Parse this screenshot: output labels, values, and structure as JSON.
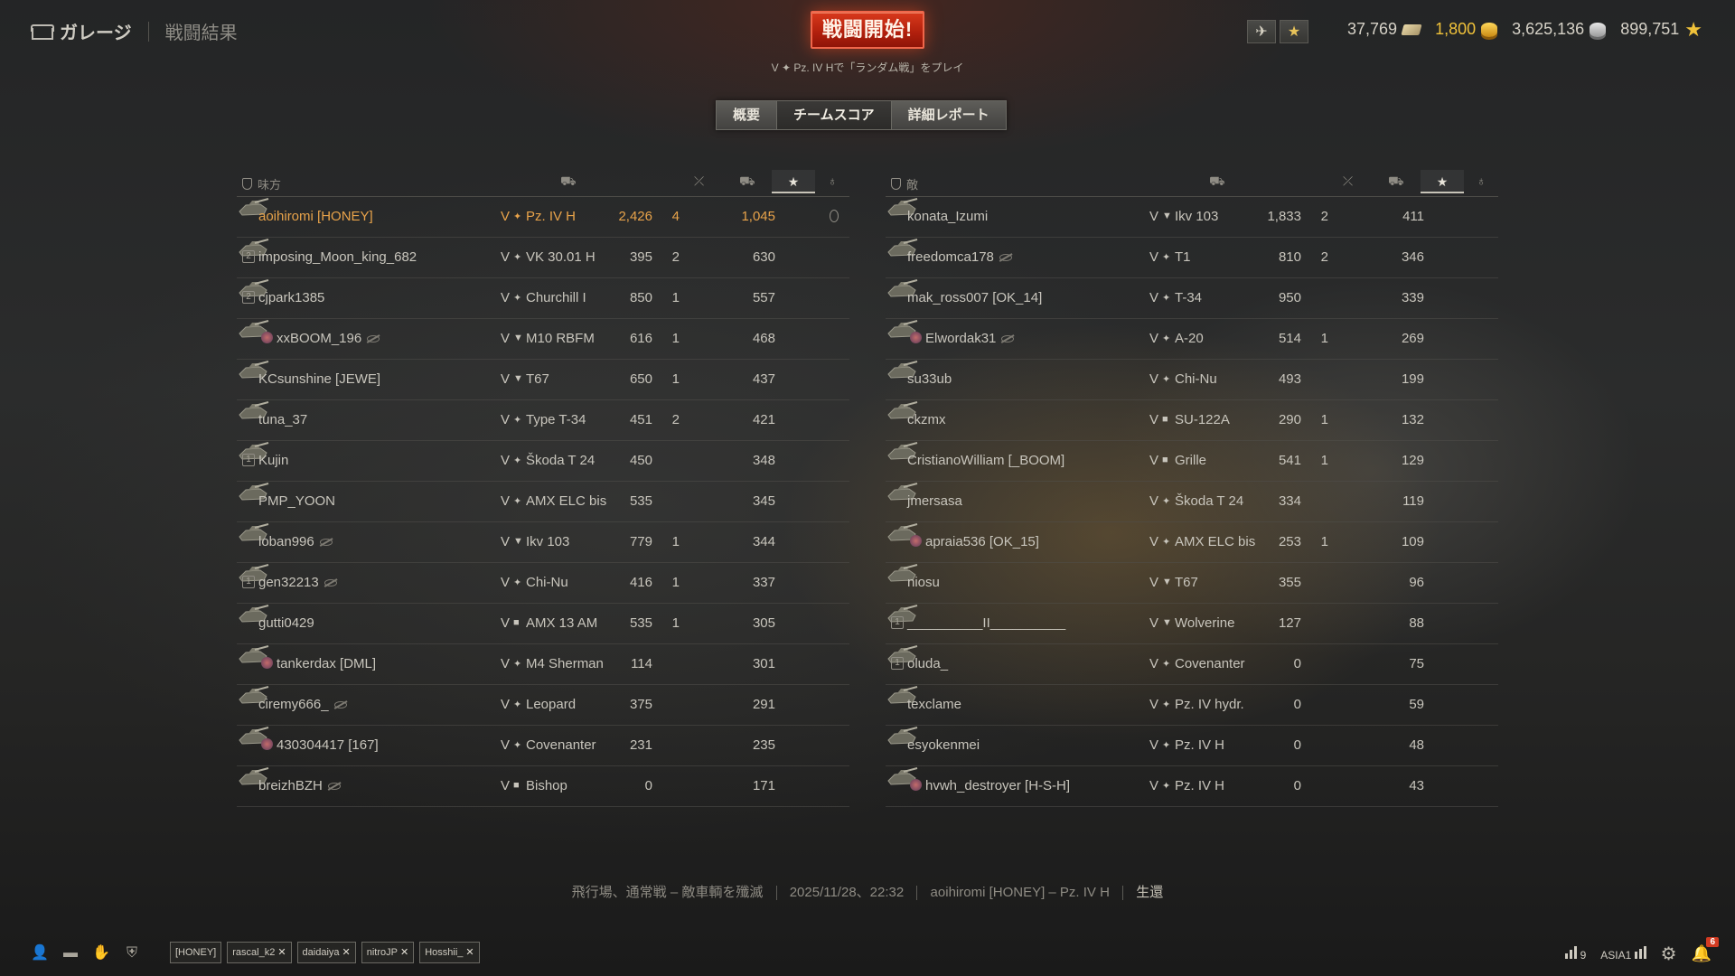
{
  "breadcrumb": {
    "garage": "ガレージ",
    "current": "戦闘結果"
  },
  "battle_button": {
    "label": "戦闘開始!",
    "subtitle": "V ✦ Pz. IV Hで「ランダム戦」をプレイ"
  },
  "currencies": [
    {
      "value": "37,769",
      "icon": "bonds-icon"
    },
    {
      "value": "1,800",
      "icon": "gold-icon",
      "highlight": true
    },
    {
      "value": "3,625,136",
      "icon": "credits-icon"
    },
    {
      "value": "899,751",
      "icon": "free-xp-icon"
    }
  ],
  "tabs": [
    {
      "label": "概要",
      "active": false
    },
    {
      "label": "チームスコア",
      "active": true
    },
    {
      "label": "詳細レポート",
      "active": false
    }
  ],
  "allies": {
    "title": "味方",
    "players": [
      {
        "name": "aoihiromi [HONEY]",
        "tier": "V",
        "type": "✦",
        "tank": "Pz. IV H",
        "damage": "2,426",
        "kills": "4",
        "xp": "1,045",
        "me": true,
        "medal": true
      },
      {
        "name": "imposing_Moon_king_682",
        "platoon": "2",
        "tier": "V",
        "type": "✦",
        "tank": "VK 30.01 H",
        "damage": "395",
        "kills": "2",
        "xp": "630"
      },
      {
        "name": "cjpark1385",
        "platoon": "2",
        "tier": "V",
        "type": "✦",
        "tank": "Churchill I",
        "damage": "850",
        "kills": "1",
        "xp": "557"
      },
      {
        "name": "xxBOOM_196",
        "badge": true,
        "dead": true,
        "tier": "V",
        "type": "▼",
        "tank": "M10 RBFM",
        "damage": "616",
        "kills": "1",
        "xp": "468"
      },
      {
        "name": "KCsunshine [JEWE]",
        "tier": "V",
        "type": "▼",
        "tank": "T67",
        "damage": "650",
        "kills": "1",
        "xp": "437"
      },
      {
        "name": "tuna_37",
        "tier": "V",
        "type": "✦",
        "tank": "Type T-34",
        "damage": "451",
        "kills": "2",
        "xp": "421"
      },
      {
        "name": "Kujin",
        "platoon": "1",
        "tier": "V",
        "type": "✦",
        "tank": "Škoda T 24",
        "damage": "450",
        "kills": "",
        "xp": "348"
      },
      {
        "name": "PMP_YOON",
        "tier": "V",
        "type": "✦",
        "tank": "AMX ELC bis",
        "damage": "535",
        "kills": "",
        "xp": "345"
      },
      {
        "name": "loban996",
        "dead": true,
        "tier": "V",
        "type": "▼",
        "tank": "Ikv 103",
        "damage": "779",
        "kills": "1",
        "xp": "344"
      },
      {
        "name": "gen32213",
        "platoon": "1",
        "dead": true,
        "tier": "V",
        "type": "✦",
        "tank": "Chi-Nu",
        "damage": "416",
        "kills": "1",
        "xp": "337"
      },
      {
        "name": "gutti0429",
        "tier": "V",
        "type": "■",
        "tank": "AMX 13 AM",
        "damage": "535",
        "kills": "1",
        "xp": "305"
      },
      {
        "name": "tankerdax [DML]",
        "badge": true,
        "tier": "V",
        "type": "✦",
        "tank": "M4 Sherman",
        "damage": "114",
        "kills": "",
        "xp": "301"
      },
      {
        "name": "ciremy666_",
        "dead": true,
        "tier": "V",
        "type": "✦",
        "tank": "Leopard",
        "damage": "375",
        "kills": "",
        "xp": "291"
      },
      {
        "name": "430304417 [167]",
        "badge": true,
        "tier": "V",
        "type": "✦",
        "tank": "Covenanter",
        "damage": "231",
        "kills": "",
        "xp": "235"
      },
      {
        "name": "breizhBZH",
        "dead": true,
        "tier": "V",
        "type": "■",
        "tank": "Bishop",
        "damage": "0",
        "kills": "",
        "xp": "171"
      }
    ]
  },
  "enemies": {
    "title": "敵",
    "players": [
      {
        "name": "konata_Izumi",
        "tier": "V",
        "type": "▼",
        "tank": "Ikv 103",
        "damage": "1,833",
        "kills": "2",
        "xp": "411"
      },
      {
        "name": "freedomca178",
        "dead": true,
        "tier": "V",
        "type": "✦",
        "tank": "T1",
        "damage": "810",
        "kills": "2",
        "xp": "346"
      },
      {
        "name": "mak_ross007 [OK_14]",
        "tier": "V",
        "type": "✦",
        "tank": "T-34",
        "damage": "950",
        "kills": "",
        "xp": "339"
      },
      {
        "name": "Elwordak31",
        "badge": true,
        "dead": true,
        "tier": "V",
        "type": "✦",
        "tank": "A-20",
        "damage": "514",
        "kills": "1",
        "xp": "269"
      },
      {
        "name": "su33ub",
        "tier": "V",
        "type": "✦",
        "tank": "Chi-Nu",
        "damage": "493",
        "kills": "",
        "xp": "199"
      },
      {
        "name": "ckzmx",
        "tier": "V",
        "type": "■",
        "tank": "SU-122A",
        "damage": "290",
        "kills": "1",
        "xp": "132"
      },
      {
        "name": "CristianoWilliam [_BOOM]",
        "tier": "V",
        "type": "■",
        "tank": "Grille",
        "damage": "541",
        "kills": "1",
        "xp": "129"
      },
      {
        "name": "jmersasa",
        "tier": "V",
        "type": "✦",
        "tank": "Škoda T 24",
        "damage": "334",
        "kills": "",
        "xp": "119"
      },
      {
        "name": "apraia536 [OK_15]",
        "badge": true,
        "tier": "V",
        "type": "✦",
        "tank": "AMX ELC bis",
        "damage": "253",
        "kills": "1",
        "xp": "109"
      },
      {
        "name": "niosu",
        "tier": "V",
        "type": "▼",
        "tank": "T67",
        "damage": "355",
        "kills": "",
        "xp": "96"
      },
      {
        "name": "__________II__________",
        "platoon": "1",
        "tier": "V",
        "type": "▼",
        "tank": "Wolverine",
        "damage": "127",
        "kills": "",
        "xp": "88"
      },
      {
        "name": "oluda_",
        "platoon": "1",
        "tier": "V",
        "type": "✦",
        "tank": "Covenanter",
        "damage": "0",
        "kills": "",
        "xp": "75"
      },
      {
        "name": "texclame",
        "tier": "V",
        "type": "✦",
        "tank": "Pz. IV hydr.",
        "damage": "0",
        "kills": "",
        "xp": "59"
      },
      {
        "name": "esyokenmei",
        "tier": "V",
        "type": "✦",
        "tank": "Pz. IV H",
        "damage": "0",
        "kills": "",
        "xp": "48"
      },
      {
        "name": "hvwh_destroyer [H-S-H]",
        "badge": true,
        "tier": "V",
        "type": "✦",
        "tank": "Pz. IV H",
        "damage": "0",
        "kills": "",
        "xp": "43"
      }
    ]
  },
  "summary": {
    "map_mode": "飛行場、通常戦 – 敵車輌を殲滅",
    "datetime": "2025/11/28、22:32",
    "player": "aoihiromi [HONEY] – Pz. IV H",
    "result": "生還"
  },
  "bottom": {
    "tags": [
      "[HONEY]",
      "rascal_k2",
      "daidaiya",
      "nitroJP",
      "Hosshii_"
    ],
    "online": "9",
    "server": "ASIA1",
    "notifications": "6"
  },
  "colors": {
    "accent": "#e8a34a",
    "battle_button": "#c42a12",
    "gold": "#f0c23a"
  }
}
